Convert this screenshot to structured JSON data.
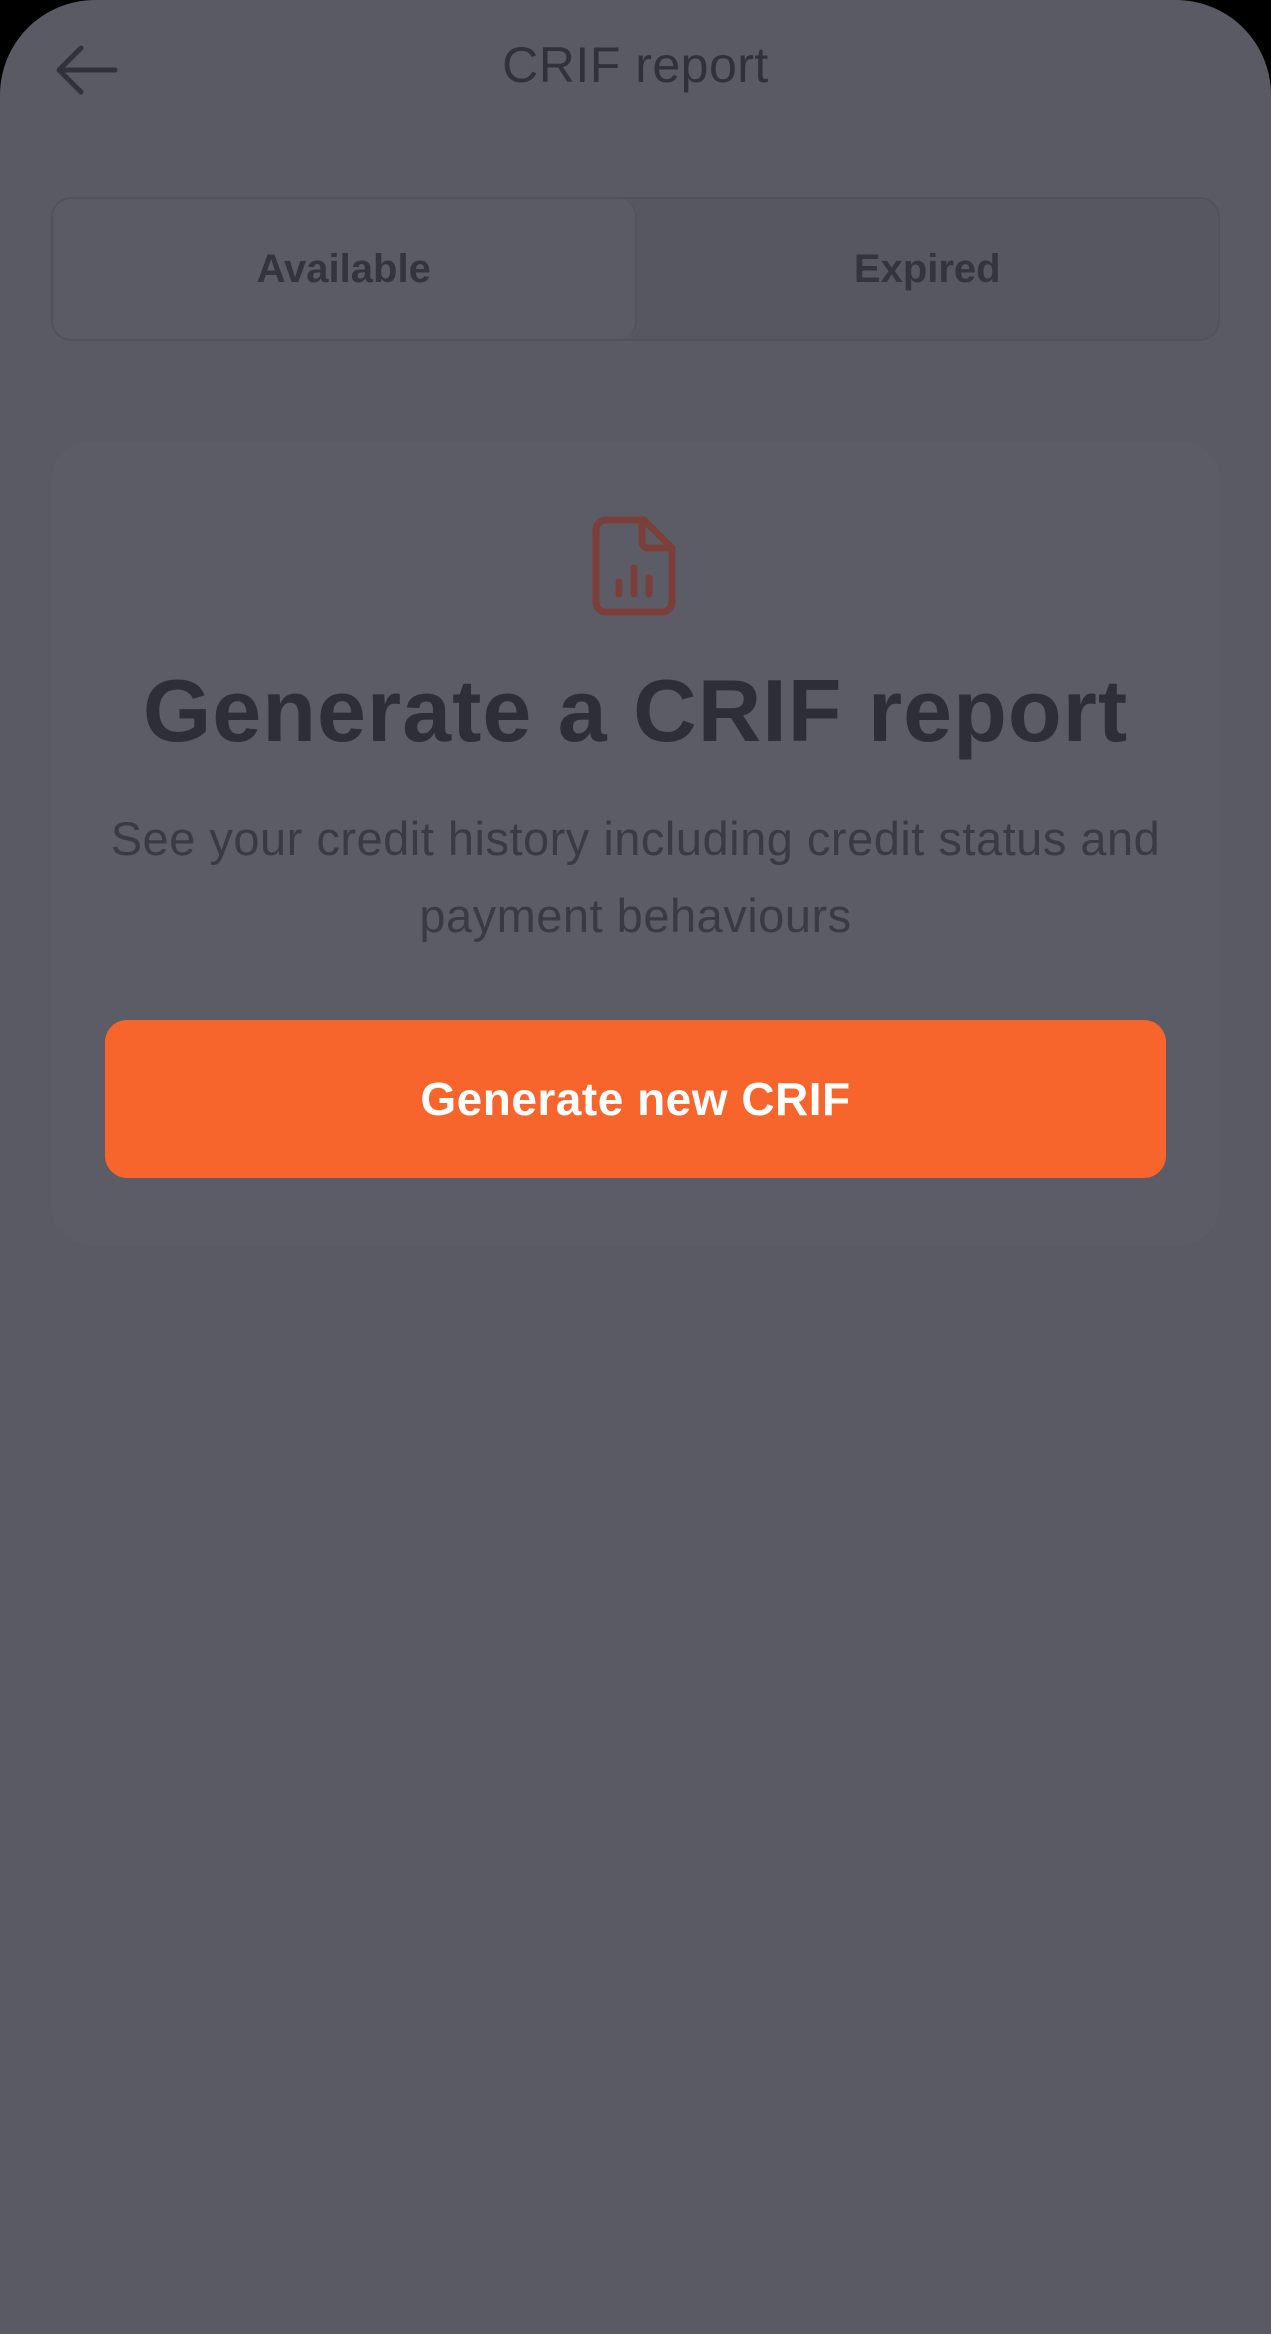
{
  "header": {
    "title": "CRIF report",
    "back_icon": "arrow-left-icon"
  },
  "tabs": [
    {
      "label": "Available",
      "active": true
    },
    {
      "label": "Expired",
      "active": false
    }
  ],
  "empty_state": {
    "icon": "document-chart-icon",
    "heading": "Generate a CRIF report",
    "description": "See your credit history including credit status and payment behaviours",
    "button_label": "Generate new CRIF"
  },
  "colors": {
    "accent": "#f8652c",
    "overlay_background": "#5a5a64",
    "icon_color": "#7a3f3a"
  }
}
